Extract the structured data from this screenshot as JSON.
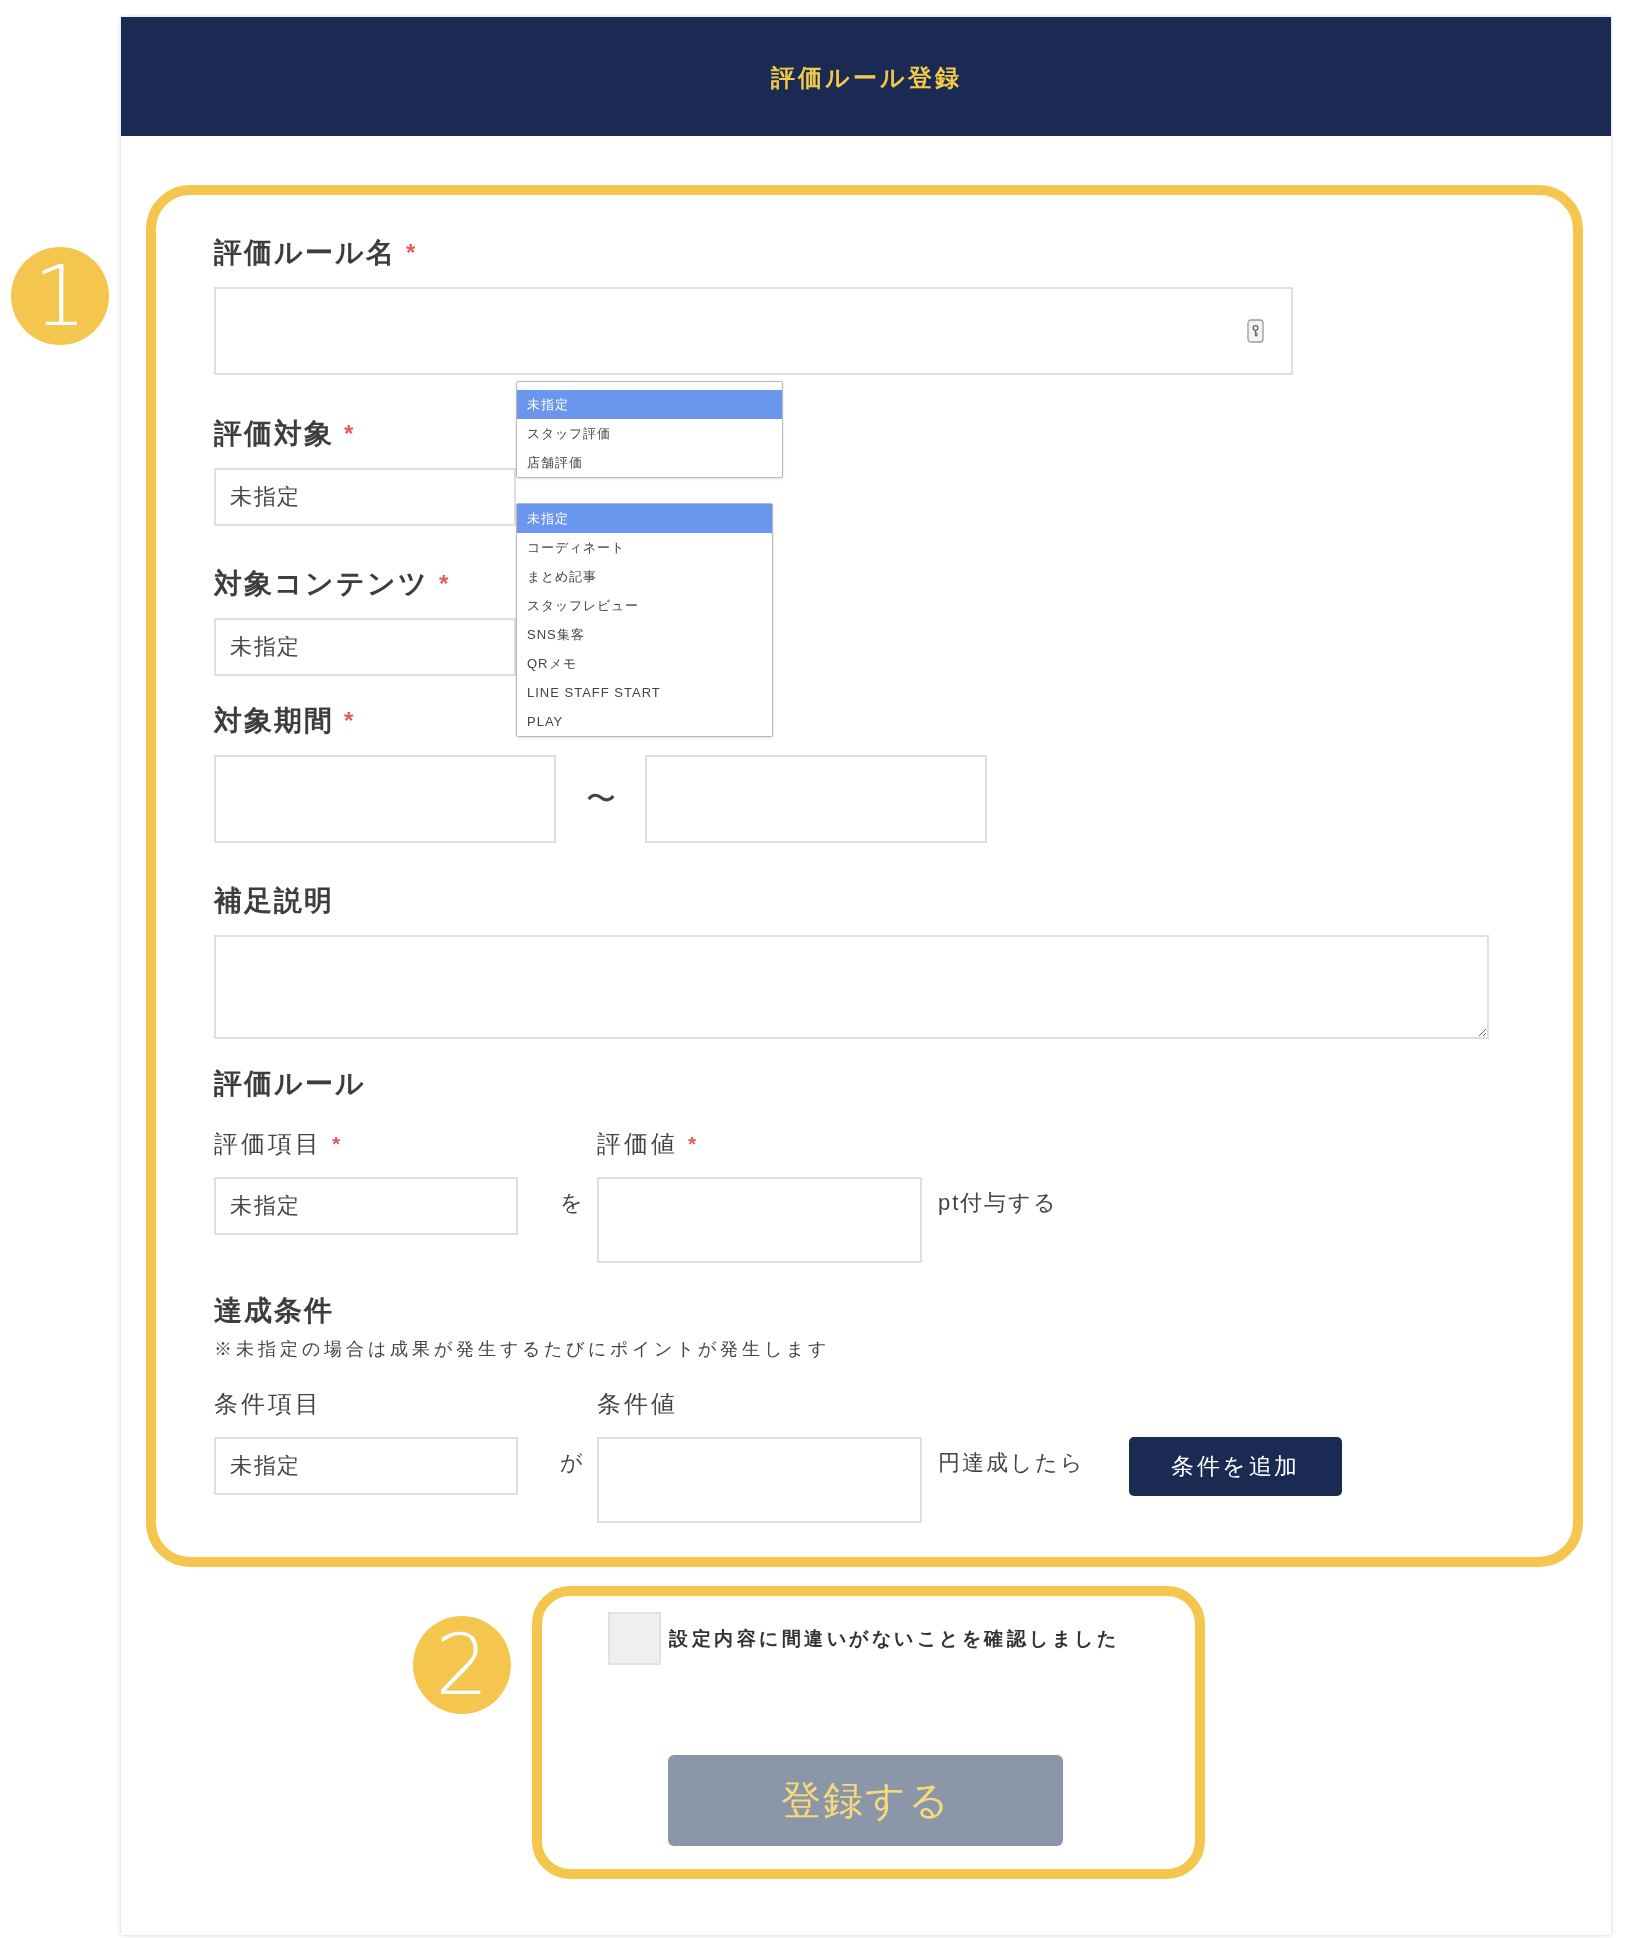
{
  "header": {
    "title": "評価ルール登録"
  },
  "basic_section": {
    "badge": "1",
    "fields": [
      {
        "kind": "text",
        "label": "評価ルール名",
        "required_mark": "*"
      },
      {
        "kind": "select",
        "label": "評価対象",
        "required_mark": "*",
        "value": "未指定",
        "dropdown": [
          {
            "label": "未指定",
            "selected": true
          },
          {
            "label": "スタッフ評価",
            "selected": false
          },
          {
            "label": "店舗評価",
            "selected": false
          }
        ]
      },
      {
        "kind": "select",
        "label": "対象コンテンツ",
        "required_mark": "*",
        "value": "未指定",
        "dropdown": [
          {
            "label": "未指定",
            "selected": true
          },
          {
            "label": "コーディネート",
            "selected": false
          },
          {
            "label": "まとめ記事",
            "selected": false
          },
          {
            "label": "スタッフレビュー",
            "selected": false
          },
          {
            "label": "SNS集客",
            "selected": false
          },
          {
            "label": "QRメモ",
            "selected": false
          },
          {
            "label": "LINE STAFF START",
            "selected": false
          },
          {
            "label": "PLAY",
            "selected": false
          }
        ]
      },
      {
        "kind": "range",
        "label": "対象期間",
        "required_mark": "*",
        "separator": "〜"
      },
      {
        "kind": "textarea",
        "label": "補足説明"
      }
    ],
    "evaluation_rule": {
      "heading": "評価ルール",
      "item_label": "評価項目",
      "item_required_mark": "*",
      "item_value": "未指定",
      "connector": "を",
      "value_label": "評価値",
      "value_required_mark": "*",
      "suffix": "pt付与する"
    },
    "achievement_condition": {
      "heading": "達成条件",
      "note": "※未指定の場合は成果が発生するたびにポイントが発生します",
      "item_label": "条件項目",
      "item_value": "未指定",
      "connector": "が",
      "value_label": "条件値",
      "suffix": "円達成したら",
      "button": "条件を追加"
    }
  },
  "confirm_section": {
    "badge": "2",
    "checkbox": {
      "label": "設定内容に間違いがないことを確認しました",
      "checked": false
    },
    "submit": {
      "label": "登録する",
      "disabled": true
    }
  }
}
